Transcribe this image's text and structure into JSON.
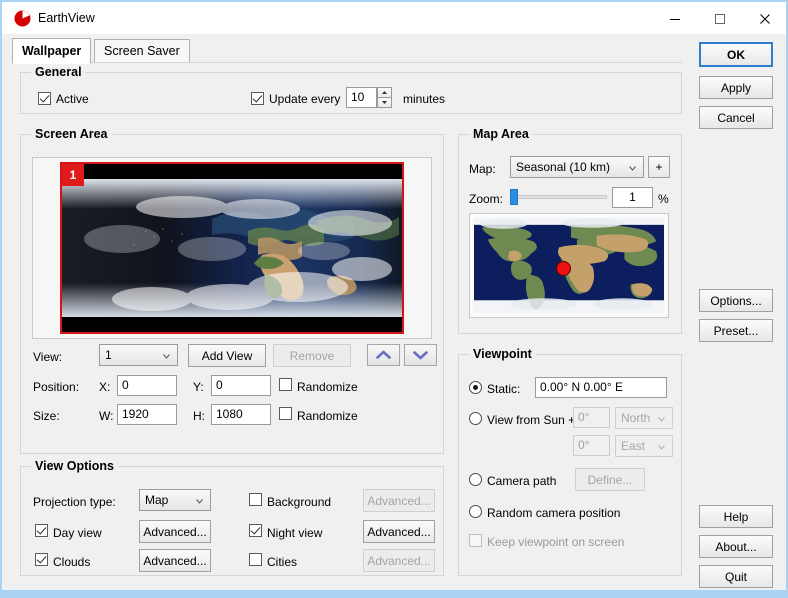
{
  "window": {
    "title": "EarthView",
    "logo_icon": "earthview-logo-icon",
    "minimize_icon": "minimize-icon",
    "maximize_icon": "maximize-icon",
    "close_icon": "close-icon"
  },
  "tabs": [
    {
      "label": "Wallpaper",
      "active": true
    },
    {
      "label": "Screen Saver",
      "active": false
    }
  ],
  "general": {
    "title": "General",
    "active_label": "Active",
    "active_checked": true,
    "update_every_label": "Update every",
    "update_every_checked": true,
    "update_value": "10",
    "minutes_label": "minutes"
  },
  "screen_area": {
    "title": "Screen Area",
    "badge": "1",
    "view_label": "View:",
    "view_value": "1",
    "add_view_label": "Add View",
    "remove_label": "Remove",
    "move_up_icon": "chevron-up-icon",
    "move_down_icon": "chevron-down-icon",
    "position_label": "Position:",
    "x_label": "X:",
    "x_value": "0",
    "y_label": "Y:",
    "y_value": "0",
    "randomize_position_label": "Randomize",
    "size_label": "Size:",
    "w_label": "W:",
    "w_value": "1920",
    "h_label": "H:",
    "h_value": "1080",
    "randomize_size_label": "Randomize"
  },
  "view_options": {
    "title": "View Options",
    "projection_label": "Projection type:",
    "projection_value": "Map",
    "day_view_label": "Day view",
    "day_view_checked": true,
    "day_view_advanced": "Advanced...",
    "clouds_label": "Clouds",
    "clouds_checked": true,
    "clouds_advanced": "Advanced...",
    "background_label": "Background",
    "background_checked": false,
    "background_advanced": "Advanced...",
    "night_view_label": "Night view",
    "night_view_checked": true,
    "night_view_advanced": "Advanced...",
    "cities_label": "Cities",
    "cities_checked": false,
    "cities_advanced": "Advanced..."
  },
  "map_area": {
    "title": "Map Area",
    "map_label": "Map:",
    "map_value": "Seasonal (10 km)",
    "add_map_label": "+",
    "zoom_label": "Zoom:",
    "zoom_value": "1",
    "zoom_unit": "%"
  },
  "viewpoint": {
    "title": "Viewpoint",
    "static_label": "Static:",
    "static_selected": true,
    "static_value": "0.00° N   0.00° E",
    "sun_label": "View from Sun +",
    "sun_angle1": "0°",
    "sun_dir1": "North",
    "sun_angle2": "0°",
    "sun_dir2": "East",
    "camera_path_label": "Camera path",
    "define_label": "Define...",
    "random_camera_label": "Random camera position",
    "keep_viewpoint_label": "Keep viewpoint on screen",
    "keep_viewpoint_checked": false
  },
  "side_buttons": {
    "ok": "OK",
    "apply": "Apply",
    "cancel": "Cancel",
    "options": "Options...",
    "preset": "Preset...",
    "help": "Help",
    "about": "About...",
    "quit": "Quit"
  },
  "colors": {
    "accent": "#2f7fd0",
    "brand_red": "#d31515",
    "window_frame": "#a9d2f3",
    "panel": "#f0f0f0"
  }
}
